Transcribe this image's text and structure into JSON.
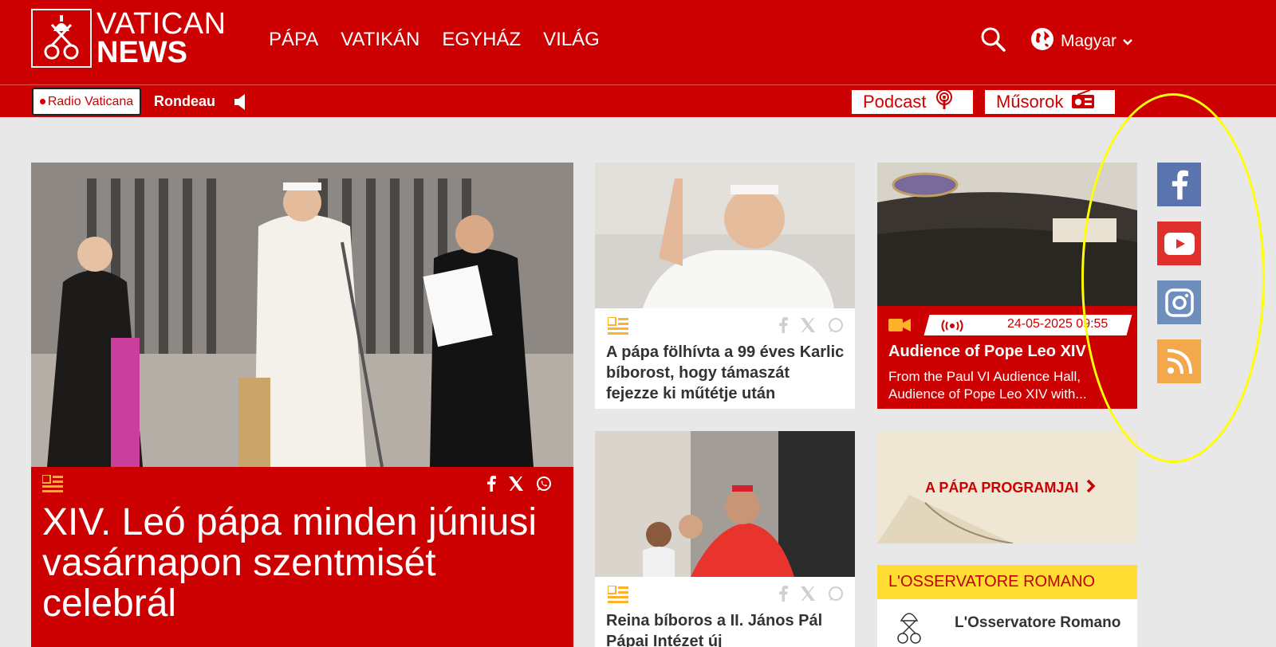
{
  "header": {
    "logo": {
      "line1": "VATICAN",
      "line2": "NEWS"
    },
    "nav": [
      "PÁPA",
      "VATIKÁN",
      "EGYHÁZ",
      "VILÁG"
    ],
    "language": "Magyar"
  },
  "subbar": {
    "radio_label": "Radio Vaticana",
    "program": "Rondeau",
    "podcast_label": "Podcast",
    "programs_label": "Műsorok"
  },
  "featured": {
    "title": "XIV. Leó pápa minden júniusi vasárnapon szentmisét celebrál"
  },
  "cards": [
    {
      "title": "A pápa fölhívta a 99 éves Karlic bíborost, hogy támaszát fejezze ki műtétje után"
    },
    {
      "title": "Reina bíboros a II. János Pál Pápai Intézet új"
    }
  ],
  "live": {
    "date": "24-05-2025 09:55",
    "title": "Audience of Pope Leo XIV",
    "description": "From the Paul VI Audience Hall, Audience of Pope Leo XIV with..."
  },
  "program_box": {
    "label": "A PÁPA PROGRAMJAI"
  },
  "osservatore": {
    "heading": "L'OSSERVATORE ROMANO",
    "name": "L'Osservatore Romano"
  },
  "social": [
    "facebook-icon",
    "youtube-icon",
    "instagram-icon",
    "rss-icon"
  ],
  "colors": {
    "brand_red": "#cc0000",
    "highlight_yellow": "#ffff00",
    "osservatore_yellow": "#ffdd33"
  }
}
